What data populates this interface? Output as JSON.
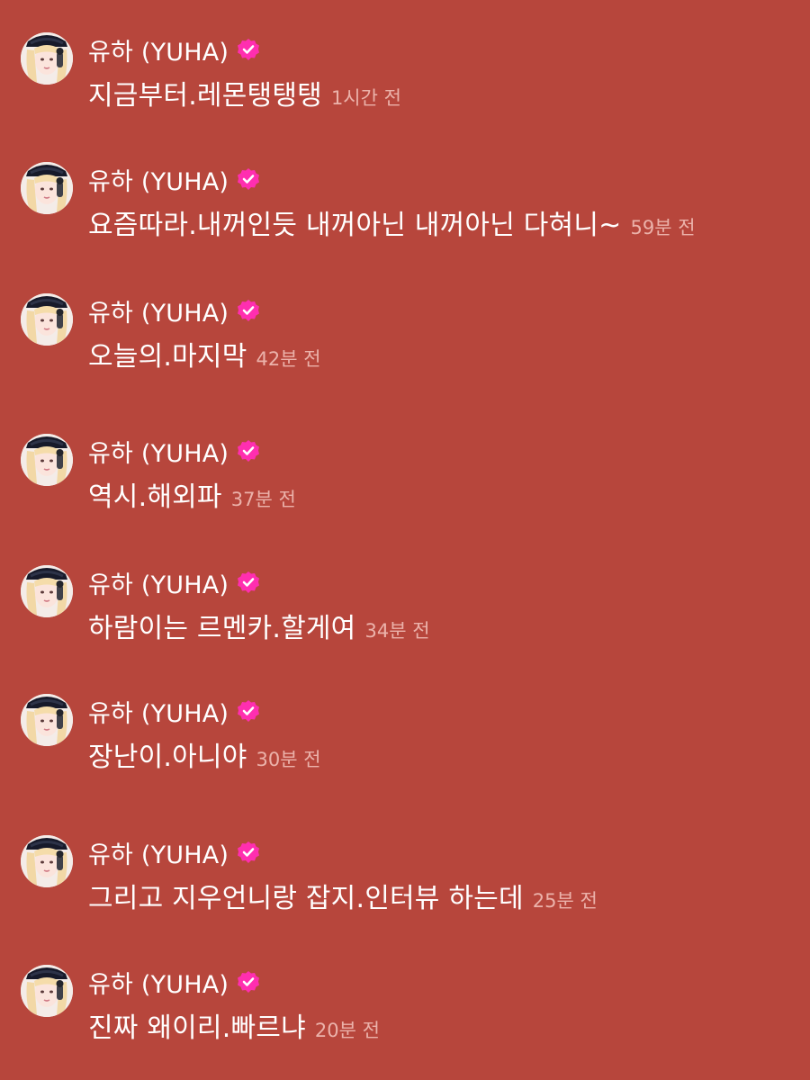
{
  "accent_color": "#ff2eb0",
  "background_color": "#b7463c",
  "messages": [
    {
      "username": "유하 (YUHA)",
      "text": "지금부터.레몬탱탱탱",
      "time": "1시간 전"
    },
    {
      "username": "유하 (YUHA)",
      "text": "요즘따라.내꺼인듯 내꺼아닌 내꺼아닌 다혀니~",
      "time": "59분 전"
    },
    {
      "username": "유하 (YUHA)",
      "text": "오늘의.마지막",
      "time": "42분 전"
    },
    {
      "username": "유하 (YUHA)",
      "text": "역시.해외파",
      "time": "37분 전"
    },
    {
      "username": "유하 (YUHA)",
      "text": "하람이는 르멘카.할게여",
      "time": "34분 전"
    },
    {
      "username": "유하 (YUHA)",
      "text": "장난이.아니야",
      "time": "30분 전"
    },
    {
      "username": "유하 (YUHA)",
      "text": "그리고 지우언니랑 잡지.인터뷰 하는데",
      "time": "25분 전"
    },
    {
      "username": "유하 (YUHA)",
      "text": "진짜 왜이리.빠르냐",
      "time": "20분 전"
    }
  ]
}
